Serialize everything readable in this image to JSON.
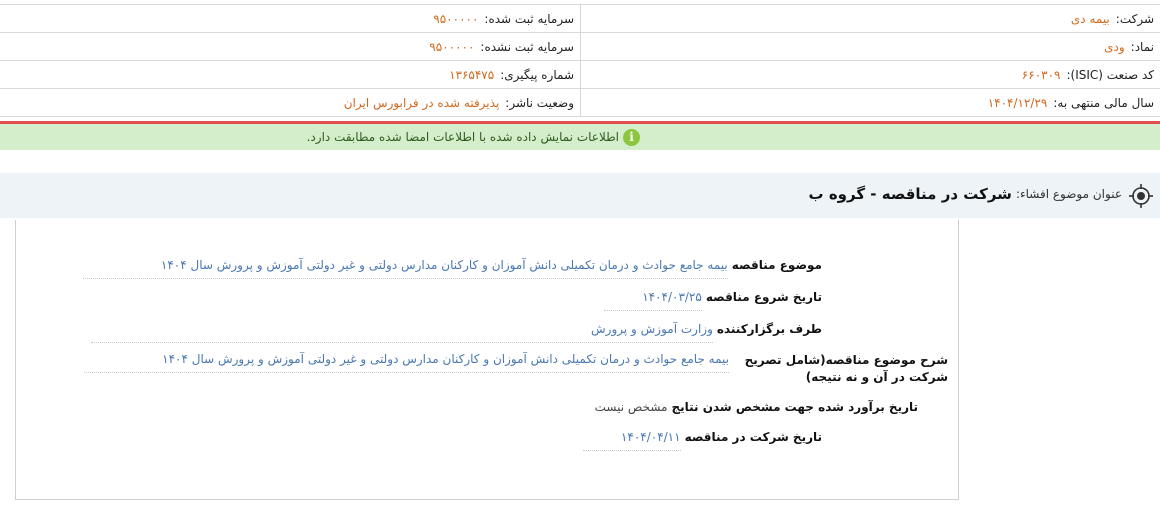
{
  "header": {
    "rows": [
      {
        "right": {
          "label": "شرکت:",
          "value": "بیمه دی"
        },
        "left": {
          "label": "سرمایه ثبت شده:",
          "value": "۹۵۰۰۰۰۰"
        }
      },
      {
        "right": {
          "label": "نماد:",
          "value": "ودی"
        },
        "left": {
          "label": "سرمایه ثبت نشده:",
          "value": "۹۵۰۰۰۰۰"
        }
      },
      {
        "right": {
          "label": "کد صنعت (ISIC):",
          "value": "۶۶۰۳۰۹"
        },
        "left": {
          "label": "شماره پیگیری:",
          "value": "۱۳۶۵۴۷۵"
        }
      },
      {
        "right": {
          "label": "سال مالی منتهی به:",
          "value": "۱۴۰۴/۱۲/۲۹"
        },
        "left": {
          "label": "وضعیت ناشر:",
          "value": "پذیرفته شده در فرابورس ایران"
        }
      }
    ]
  },
  "notice": {
    "icon": "info-icon",
    "text": "اطلاعات نمایش داده شده با اطلاعات امضا شده مطابقت دارد.",
    "background": "#d4edcb",
    "icon_color": "#8cc63f"
  },
  "subject": {
    "icon": "target-icon",
    "label": "عنوان موضوع افشاء:",
    "value": "شرکت در مناقصه - گروه ب"
  },
  "details": [
    {
      "label": "موضوع مناقصه",
      "value": "بیمه جامع حوادث و درمان تکمیلی دانش آموزان و کارکنان مدارس دولتی و غیر دولتی آموزش و پرورش سال ۱۴۰۴"
    },
    {
      "label": "تاریخ شروع مناقصه",
      "value": "۱۴۰۴/۰۳/۲۵"
    },
    {
      "label": "طرف برگزارکننده",
      "value": "وزارت آموزش و پرورش"
    },
    {
      "label": "شرح موضوع مناقصه(شامل تصریح شرکت در آن و نه نتیجه)",
      "value": "بیمه جامع حوادث و درمان تکمیلی دانش آموزان و کارکنان مدارس دولتی و غیر دولتی آموزش و پرورش سال ۱۴۰۴"
    },
    {
      "label": "تاریخ برآورد شده جهت مشخص شدن نتایج",
      "value": "مشخص نیست"
    },
    {
      "label": "تاریخ شرکت در مناقصه",
      "value": "۱۴۰۴/۰۴/۱۱"
    }
  ],
  "colors": {
    "value_orange": "#d2691e",
    "link_blue": "#4a78b0",
    "divider_red": "#e05050",
    "subject_bg": "#eef3f7"
  }
}
